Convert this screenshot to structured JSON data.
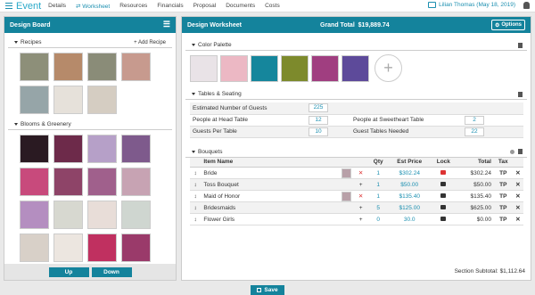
{
  "nav": {
    "brand": "Event",
    "items": [
      "Details",
      "Worksheet",
      "Resources",
      "Financials",
      "Proposal",
      "Documents",
      "Costs"
    ],
    "active": "Worksheet",
    "user": "Lilian Thomas (May 18, 2019)"
  },
  "board": {
    "title": "Design Board",
    "recipes_label": "Recipes",
    "add_recipe": "+ Add Recipe",
    "blooms_label": "Blooms & Greenery",
    "up": "Up",
    "down": "Down",
    "recipe_colors": [
      "#8d8f79",
      "#b68a6a",
      "#8a8c78",
      "#c79a8e",
      "#96a5a8",
      "#e6e1da",
      "#d5cdc2"
    ],
    "bloom_colors": [
      "#2a1a22",
      "#6d2a4a",
      "#b6a0c8",
      "#7e5a8c",
      "#c84a7c",
      "#8e4468",
      "#a0608c",
      "#c7a3b3",
      "#b48ec0",
      "#d7d8d0",
      "#e8ddd8",
      "#cfd6d0",
      "#d8d0c8",
      "#ece6e0",
      "#c03060",
      "#9a3a6a"
    ]
  },
  "worksheet": {
    "title": "Design Worksheet",
    "grand_total_label": "Grand Total",
    "grand_total": "$19,889.74",
    "options": "Options",
    "palette_label": "Color Palette",
    "palette": [
      "#e9e3e7",
      "#ecb8c4",
      "#15869c",
      "#7d8a2c",
      "#a03e80",
      "#5d4a9a"
    ],
    "tables_label": "Tables & Seating",
    "seating": {
      "guests_label": "Estimated Number of Guests",
      "guests": "225",
      "head_label": "People at Head Table",
      "head": "12",
      "sweet_label": "People at Sweetheart Table",
      "sweet": "2",
      "per_label": "Guests Per Table",
      "per": "10",
      "needed_label": "Guest Tables Needed",
      "needed": "22"
    },
    "bouquets_label": "Bouquets",
    "columns": [
      "Item Name",
      "Qty",
      "Est Price",
      "Lock",
      "Total",
      "Tax"
    ],
    "rows": [
      {
        "name": "Bride",
        "mark": "✕",
        "qty": "1",
        "price": "$302.24",
        "total": "$302.24",
        "tax": "TP",
        "img": true,
        "locked": true
      },
      {
        "name": "Toss Bouquet",
        "mark": "+",
        "qty": "1",
        "price": "$50.00",
        "total": "$50.00",
        "tax": "TP",
        "img": false,
        "locked": false
      },
      {
        "name": "Maid of Honor",
        "mark": "✕",
        "qty": "1",
        "price": "$135.40",
        "total": "$135.40",
        "tax": "TP",
        "img": true,
        "locked": false
      },
      {
        "name": "Bridesmaids",
        "mark": "+",
        "qty": "5",
        "price": "$125.00",
        "total": "$625.00",
        "tax": "TP",
        "img": false,
        "locked": false
      },
      {
        "name": "Flower Girls",
        "mark": "+",
        "qty": "0",
        "price": "30.0",
        "total": "$0.00",
        "tax": "TP",
        "img": false,
        "locked": false
      }
    ],
    "subtotal_label": "Section Subtotal:",
    "subtotal": "$1,112.64"
  },
  "save": "Save"
}
